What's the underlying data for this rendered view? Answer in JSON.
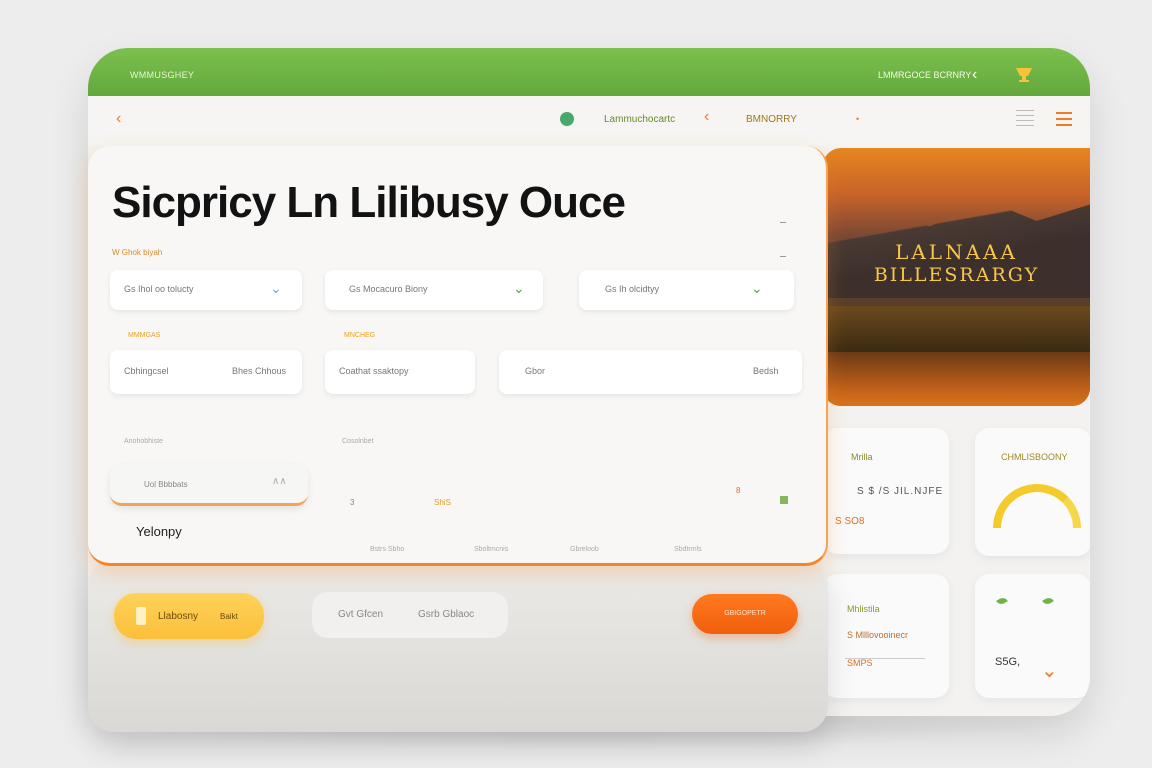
{
  "topbar": {
    "brand": "WMMUSGHEY",
    "right_label": "LMMRGOCE BCRNRY"
  },
  "toolbar": {
    "nav1": "Lammuchocartc",
    "nav2": "BMNORRY"
  },
  "hero": {
    "line1": "LALNAAA",
    "line2": "BILLESRARGY"
  },
  "cards": {
    "a": {
      "label": "Mrilla",
      "value": "S $ /S JIL.NJFE",
      "sub": "S SO8"
    },
    "b": {
      "label": "CHMLISBOONY"
    },
    "c": {
      "label": "Mhlistila",
      "row1": "S Mlllovooinecr",
      "row2": "SMPS"
    },
    "d": {
      "value": "S5G,"
    }
  },
  "panel": {
    "title": "Sicpricy Ln Lilibusy Ouce",
    "small_label": "W Ghok biyah",
    "fields": [
      {
        "text": "Gs Ihol oo tolucty"
      },
      {
        "text": "Gs Mocacuro Biony"
      },
      {
        "text": "Gs Ih olcidtyy"
      }
    ],
    "orange_labels": [
      "MMMGAS",
      "MNCHEG"
    ],
    "selects": [
      {
        "left": "Cbhingcsel",
        "right": "Bhes Chhous"
      },
      {
        "left": "Coathat ssaktopy"
      },
      {
        "left": "Gbor",
        "right": "Bedsh"
      }
    ],
    "row_headers": [
      "Anohobhiste",
      "Cosolnbet"
    ],
    "pill": {
      "text": "Uol Bbbbats",
      "mark": "∧∧"
    },
    "row_items": [
      "3",
      "ShiS",
      "8"
    ],
    "name": "Yelonpy",
    "footers": [
      "Bstrs Sbho",
      "Sboltmcnis",
      "Gbreloob",
      "Sbdtrmls"
    ]
  },
  "actions": {
    "yellow_button": "Llabosny",
    "yellow_sub": "Baikt",
    "seg1": "Gvt Gfcen",
    "seg2": "Gsrb Gblaoc",
    "orange_button": "GBIGOPETR"
  }
}
